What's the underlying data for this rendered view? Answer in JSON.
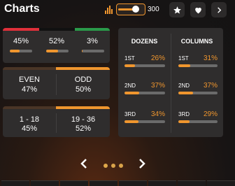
{
  "header": {
    "title": "Charts",
    "limit_value": "300",
    "slider_level_fraction": 0.55,
    "icons": [
      "bar-chart-icon",
      "star-icon",
      "heart-icon",
      "chevron-right-icon"
    ]
  },
  "colors": {
    "accent": "#f0962e",
    "red": "#e0303a",
    "black": "#111111",
    "green": "#2a9a4a",
    "panel": "#2f2d2d"
  },
  "color_split": [
    {
      "name": "red",
      "pct": "45%",
      "fraction": 0.45
    },
    {
      "name": "black",
      "pct": "52%",
      "fraction": 0.52
    },
    {
      "name": "green",
      "pct": "3%",
      "fraction": 0.03
    }
  ],
  "even_odd": [
    {
      "label": "EVEN",
      "pct": "47%",
      "fraction": 0.47
    },
    {
      "label": "ODD",
      "pct": "50%",
      "fraction": 0.5
    }
  ],
  "low_high": [
    {
      "label": "1 - 18",
      "pct": "45%",
      "fraction": 0.45
    },
    {
      "label": "19 - 36",
      "pct": "52%",
      "fraction": 0.52
    }
  ],
  "dozens": {
    "heading": "DOZENS",
    "rows": [
      {
        "label": "1ST",
        "pct": "26%",
        "fraction": 0.26
      },
      {
        "label": "2ND",
        "pct": "37%",
        "fraction": 0.37
      },
      {
        "label": "3RD",
        "pct": "34%",
        "fraction": 0.34
      }
    ]
  },
  "columns": {
    "heading": "COLUMNS",
    "rows": [
      {
        "label": "1ST",
        "pct": "31%",
        "fraction": 0.31
      },
      {
        "label": "2ND",
        "pct": "37%",
        "fraction": 0.37
      },
      {
        "label": "3RD",
        "pct": "29%",
        "fraction": 0.29
      }
    ]
  },
  "pager": {
    "pages": 3,
    "current": 1
  }
}
